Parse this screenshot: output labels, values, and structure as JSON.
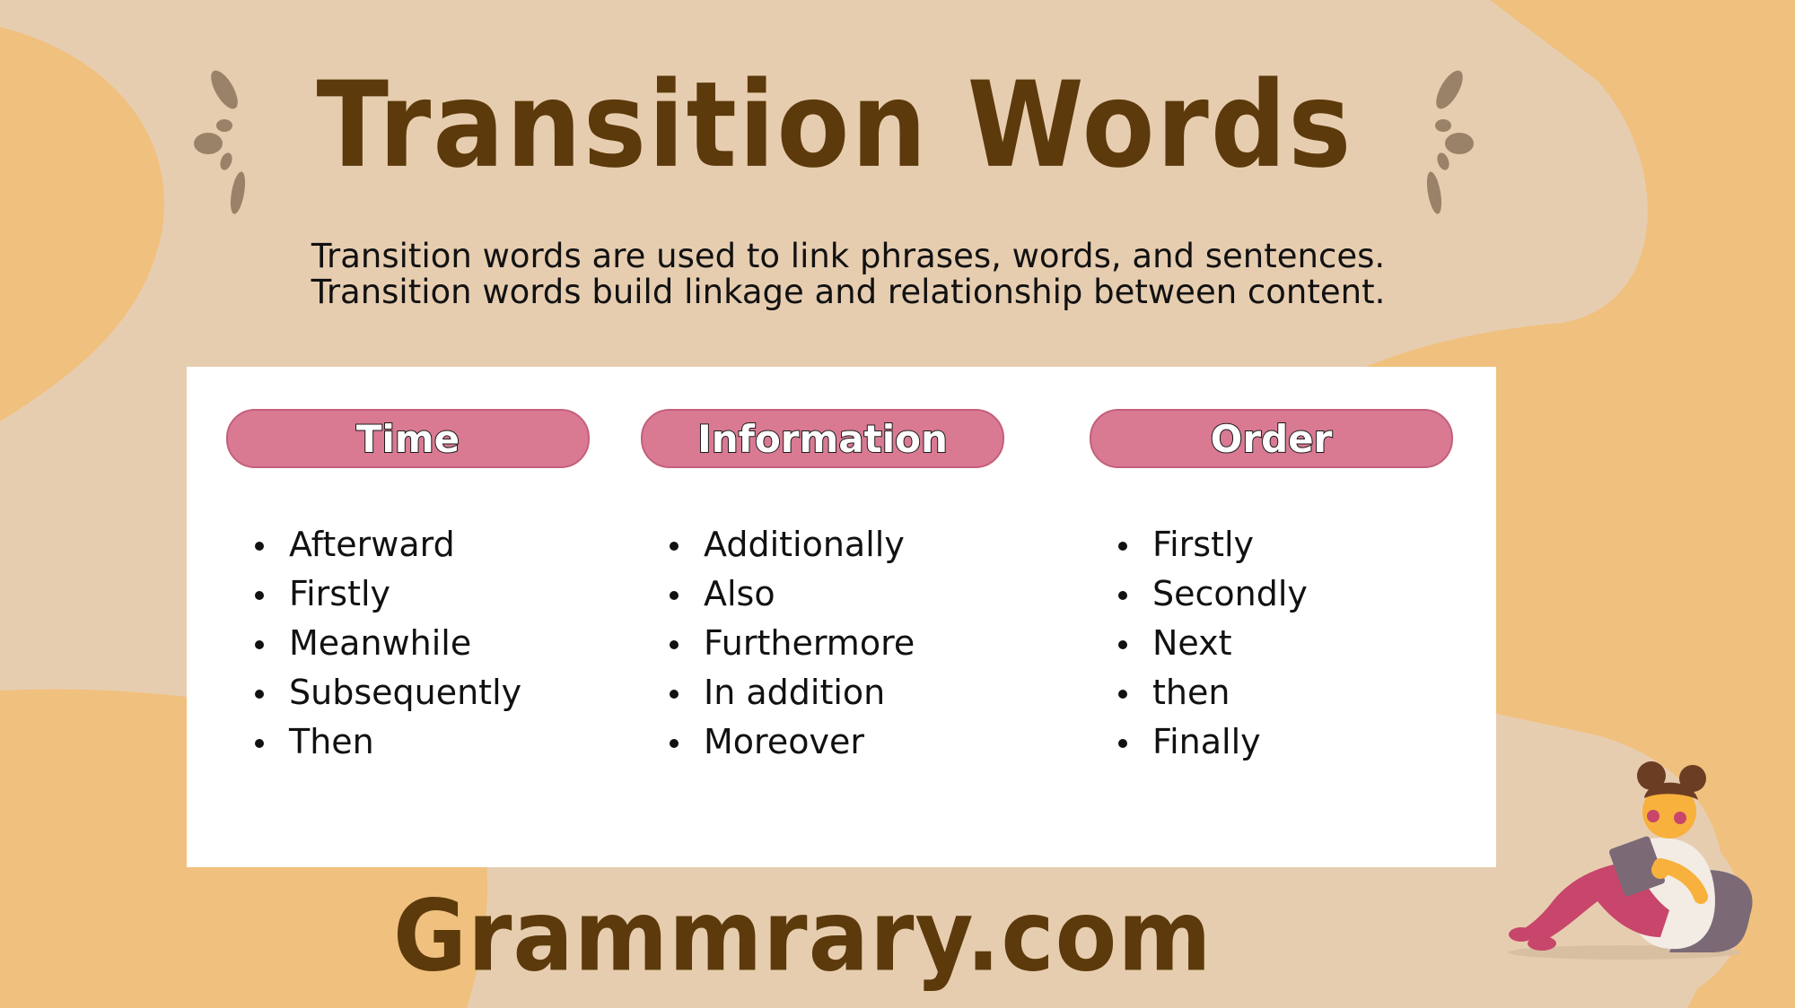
{
  "title": "Transition Words",
  "subtitle": {
    "line1": "Transition words are used to link phrases, words, and sentences.",
    "line2": "Transition words build linkage and relationship between content."
  },
  "columns": [
    {
      "heading": "Time",
      "items": [
        "Afterward",
        "Firstly",
        "Meanwhile",
        "Subsequently",
        "Then"
      ]
    },
    {
      "heading": "Information",
      "items": [
        "Additionally",
        "Also",
        "Furthermore",
        "In addition",
        "Moreover"
      ]
    },
    {
      "heading": "Order",
      "items": [
        "Firstly",
        "Secondly",
        "Next",
        "then",
        "Finally"
      ]
    }
  ],
  "brand": "Grammrary.com",
  "colors": {
    "background_light": "#e7cdb0",
    "background_orange": "#f0c07e",
    "title_brown": "#5c3a0b",
    "heading_pink": "#d97a92",
    "spark_gray": "#9a8269"
  },
  "icons": {
    "left_decoration": "sparkle-lines-icon",
    "right_decoration": "sparkle-lines-icon",
    "illustration": "girl-reading-book-illustration"
  }
}
